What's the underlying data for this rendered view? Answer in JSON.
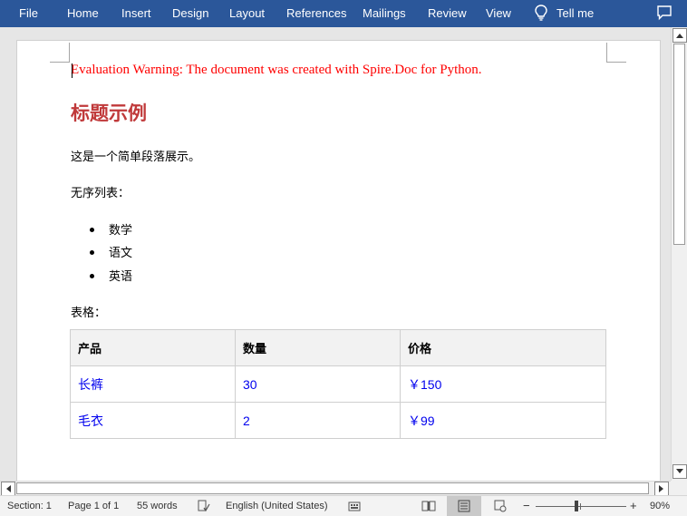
{
  "ribbon": {
    "tabs": [
      "File",
      "Home",
      "Insert",
      "Design",
      "Layout",
      "References",
      "Mailings",
      "Review",
      "View"
    ],
    "tell_me": "Tell me"
  },
  "document": {
    "warning": "Evaluation Warning: The document was created with Spire.Doc for Python.",
    "heading": "标题示例",
    "paragraph": "这是一个简单段落展示。",
    "list_label": "无序列表：",
    "list_items": [
      "数学",
      "语文",
      "英语"
    ],
    "table_label": "表格：",
    "table": {
      "headers": [
        "产品",
        "数量",
        "价格"
      ],
      "rows": [
        [
          "长裤",
          "30",
          "￥150"
        ],
        [
          "毛衣",
          "2",
          "￥99"
        ]
      ]
    }
  },
  "status_bar": {
    "section": "Section: 1",
    "page": "Page 1 of 1",
    "words": "55 words",
    "language": "English (United States)",
    "zoom_minus": "−",
    "zoom_plus": "+",
    "zoom": "90%"
  },
  "colors": {
    "ribbon": "#2b579a",
    "warning": "#ff0000",
    "heading": "#c0393a",
    "table_text": "#0000ee"
  }
}
